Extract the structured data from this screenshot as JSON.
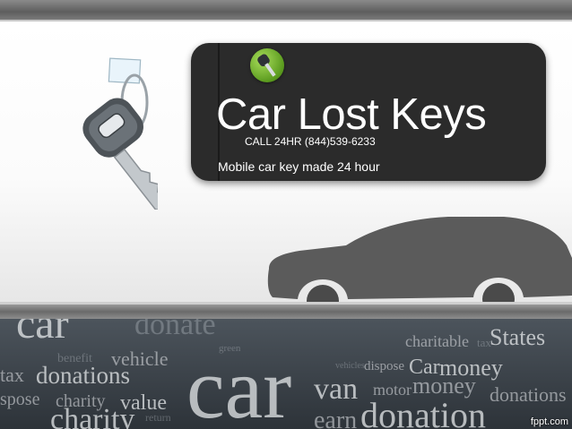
{
  "title_card": {
    "title": "Car Lost Keys",
    "phone": "CALL 24HR (844)539-6233",
    "subtitle": "Mobile car key made 24 hour",
    "badge_icon": "car-key-badge-icon"
  },
  "word_cloud": {
    "words": [
      "car",
      "donate",
      "charitable",
      "tax",
      "States",
      "vehicle",
      "benefit",
      "donations",
      "Car",
      "money",
      "dispose",
      "vehicles",
      "car",
      "van",
      "motor",
      "money",
      "donations",
      "charity",
      "value",
      "return",
      "charity",
      "earn",
      "donation",
      "green",
      "tax",
      "spose"
    ]
  },
  "watermark": "fppt.com",
  "colors": {
    "card_background": "#2b2b2b",
    "badge_green": "#6fb12a",
    "silhouette_gray": "#5e5e5e",
    "key_gray": "#7d8388"
  }
}
